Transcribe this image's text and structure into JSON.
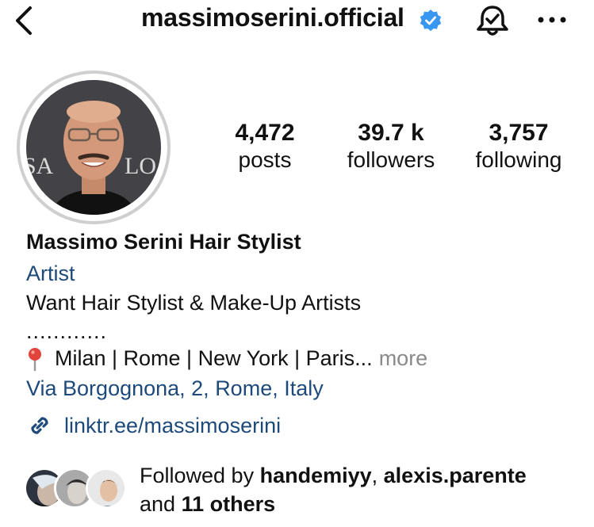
{
  "header": {
    "username": "massimoserini.official",
    "verified_icon": "verified-badge-icon",
    "back_icon": "chevron-left-icon",
    "notifications_icon": "bell-check-icon",
    "more_icon": "more-horizontal-icon",
    "verified_color": "#3897f0"
  },
  "stats": {
    "posts": {
      "value": "4,472",
      "label": "posts"
    },
    "followers": {
      "value": "39.7 k",
      "label": "followers"
    },
    "following": {
      "value": "3,757",
      "label": "following"
    }
  },
  "profile": {
    "name": "Massimo Serini Hair Stylist",
    "category": "Artist",
    "bio_line": "Want Hair Stylist & Make-Up Artists",
    "dots_line": "............",
    "location": "Milan | Rome | New York | Paris...",
    "more_label": "more",
    "address": "Via Borgognona, 2, Rome, Italy",
    "link": "linktr.ee/massimoserini",
    "link_color": "#1d4a7a",
    "backdrop_text_left": "SA",
    "backdrop_text_right": "LO"
  },
  "followed_by": {
    "prefix": "Followed by ",
    "user1": "handemiyy",
    "separator": ", ",
    "user2": "alexis.parente",
    "middle": "and ",
    "others": "11 others"
  }
}
